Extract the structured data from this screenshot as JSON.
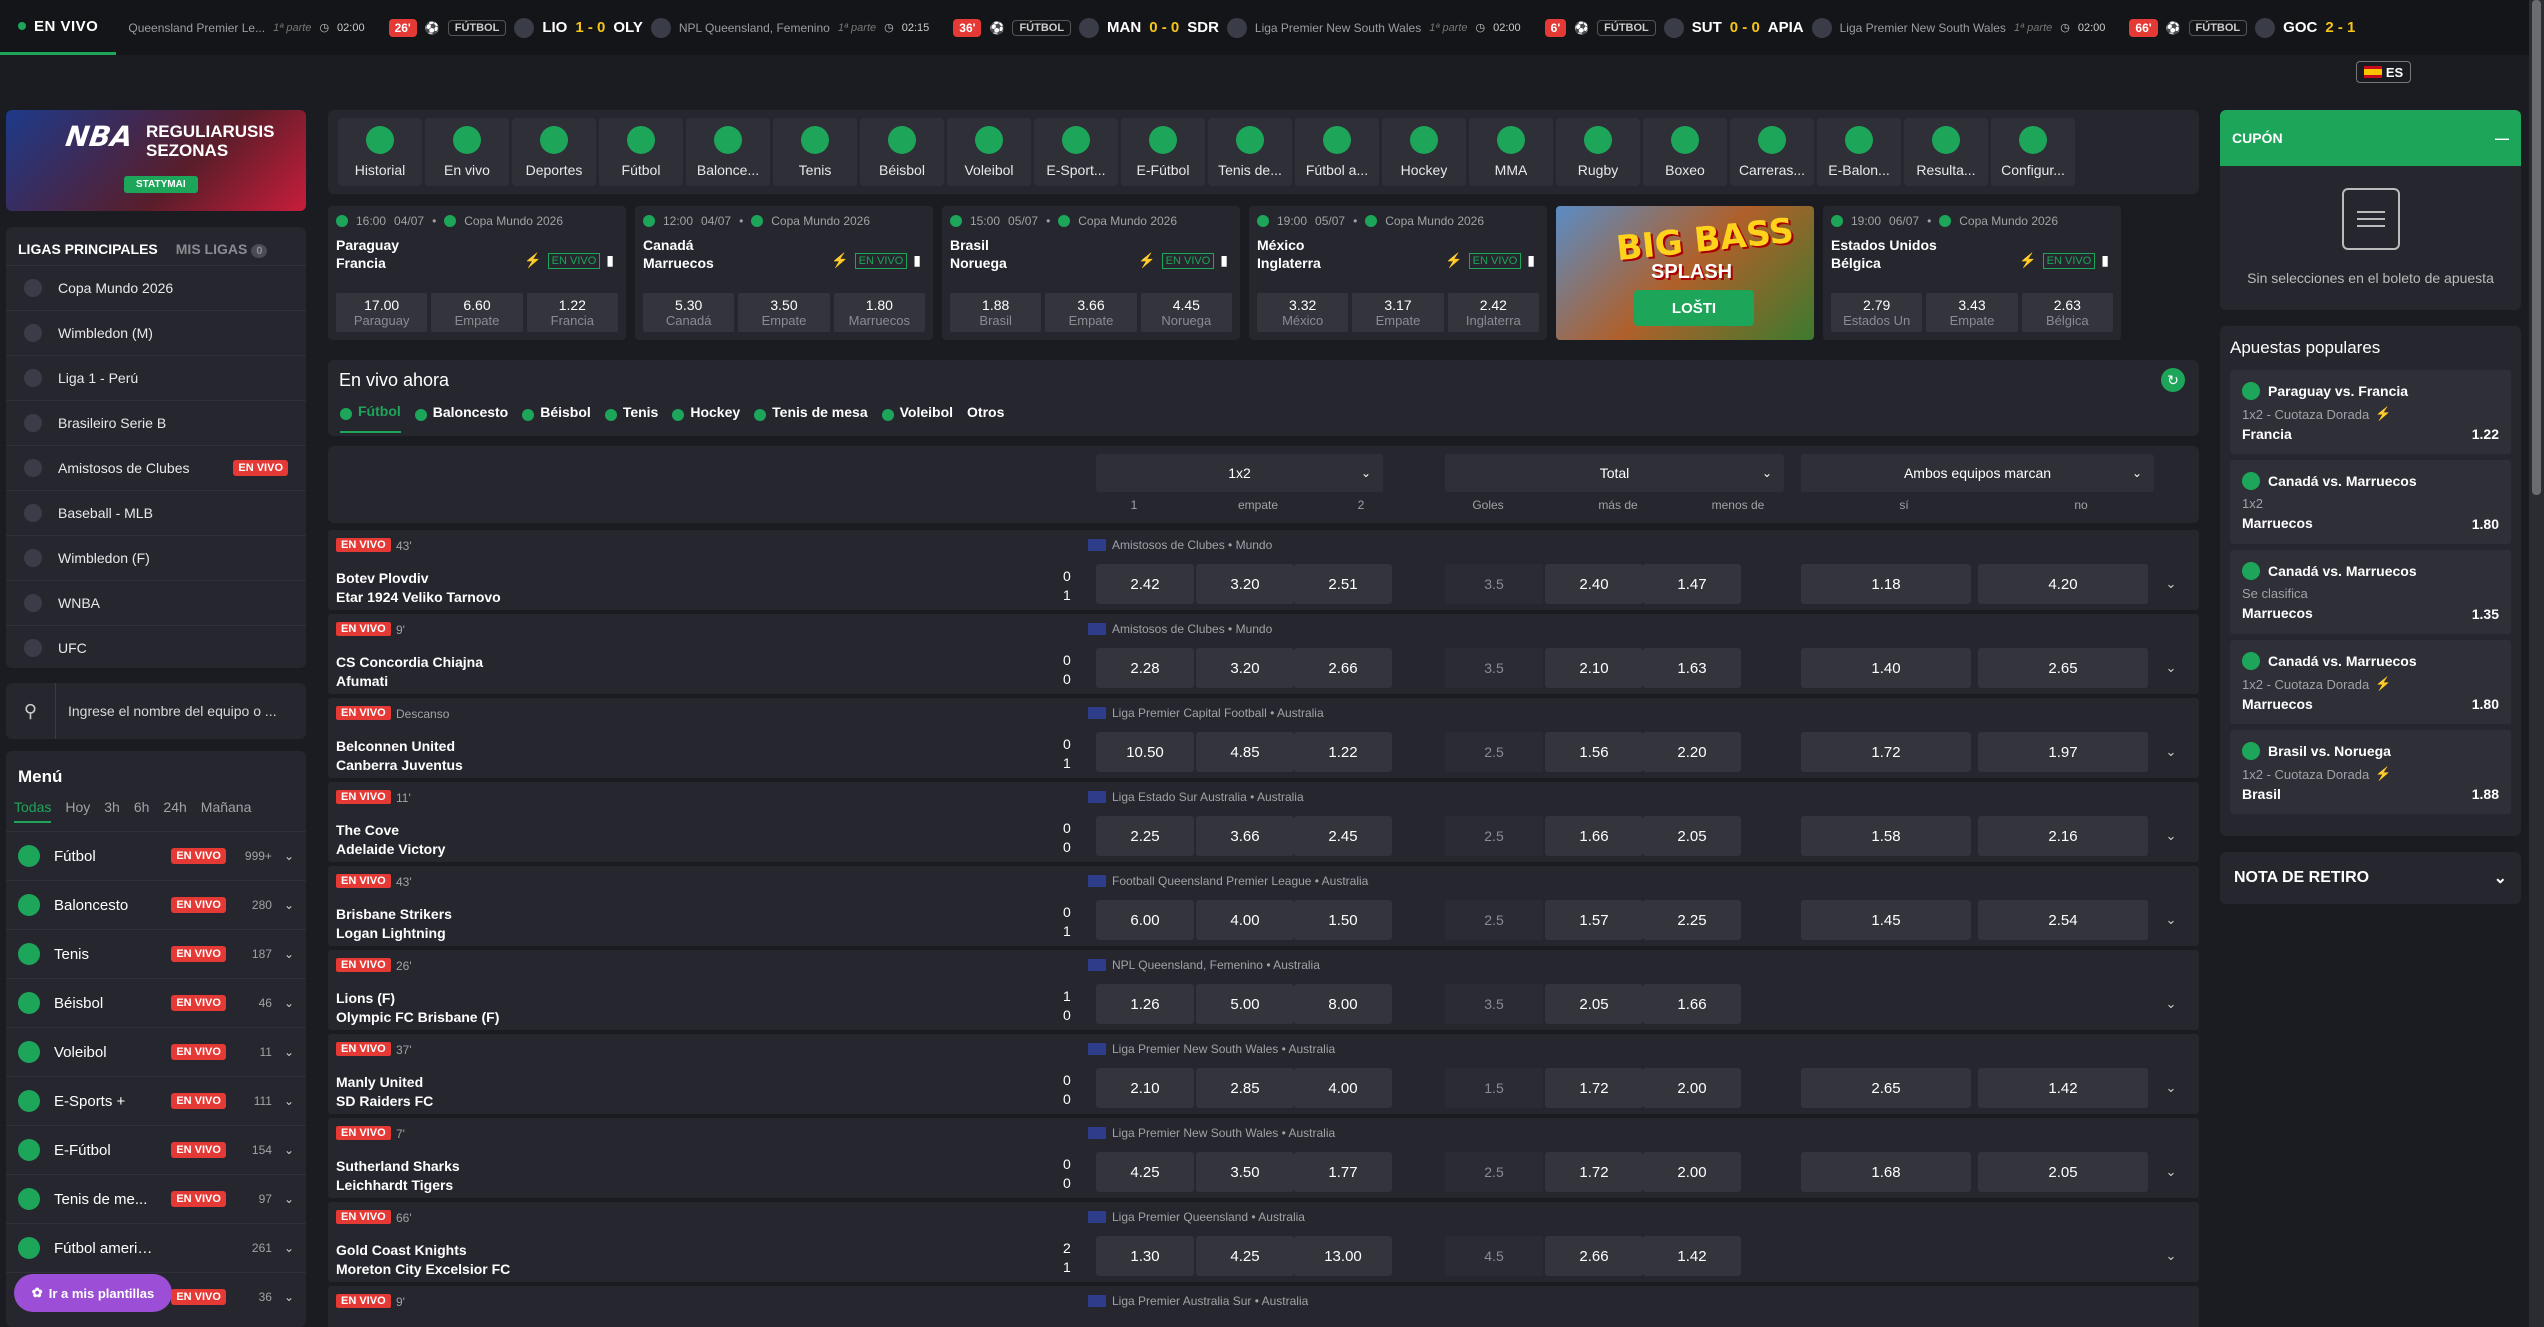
{
  "ticker": {
    "live_label": "EN VIVO",
    "items": [
      {
        "tail": "Queensland Premier Le...",
        "phase": "1ª parte",
        "clock": "02:00"
      },
      {
        "min": "26'",
        "sport": "FÚTBOL",
        "home": "LIO",
        "score": "1 - 0",
        "away": "OLY",
        "league": "NPL Queensland, Femenino",
        "phase": "1ª parte",
        "clock": "02:15"
      },
      {
        "min": "36'",
        "sport": "FÚTBOL",
        "home": "MAN",
        "score": "0 - 0",
        "away": "SDR",
        "league": "Liga Premier New South Wales",
        "phase": "1ª parte",
        "clock": "02:00"
      },
      {
        "min": "6'",
        "sport": "FÚTBOL",
        "home": "SUT",
        "score": "0 - 0",
        "away": "APIA",
        "league": "Liga Premier New South Wales",
        "phase": "1ª parte",
        "clock": "02:00"
      },
      {
        "min": "66'",
        "sport": "FÚTBOL",
        "home": "GOC",
        "score": "2 - 1",
        "away": "",
        "league": "",
        "phase": "",
        "clock": ""
      }
    ]
  },
  "lang": "ES",
  "nba": {
    "title": "NBA",
    "text": "REGULIARUSIS SEZONAS",
    "button": "STATYMAI"
  },
  "leagues": {
    "tab_main": "LIGAS PRINCIPALES",
    "tab_mine": "MIS LIGAS",
    "mine_count": "0",
    "items": [
      {
        "name": "Copa Mundo 2026",
        "live": ""
      },
      {
        "name": "Wimbledon (M)",
        "live": ""
      },
      {
        "name": "Liga 1 - Perú",
        "live": ""
      },
      {
        "name": "Brasileiro Serie B",
        "live": ""
      },
      {
        "name": "Amistosos de Clubes",
        "live": "EN VIVO"
      },
      {
        "name": "Baseball - MLB",
        "live": ""
      },
      {
        "name": "Wimbledon (F)",
        "live": ""
      },
      {
        "name": "WNBA",
        "live": ""
      },
      {
        "name": "UFC",
        "live": ""
      }
    ]
  },
  "search": {
    "placeholder": "Ingrese el nombre del equipo o ..."
  },
  "menu": {
    "title": "Menú",
    "tabs": [
      "Todas",
      "Hoy",
      "3h",
      "6h",
      "24h",
      "Mañana"
    ],
    "items": [
      {
        "name": "Fútbol",
        "live": "EN VIVO",
        "count": "999+"
      },
      {
        "name": "Baloncesto",
        "live": "EN VIVO",
        "count": "280"
      },
      {
        "name": "Tenis",
        "live": "EN VIVO",
        "count": "187"
      },
      {
        "name": "Béisbol",
        "live": "EN VIVO",
        "count": "46"
      },
      {
        "name": "Voleibol",
        "live": "EN VIVO",
        "count": "11"
      },
      {
        "name": "E-Sports +",
        "live": "EN VIVO",
        "count": "111"
      },
      {
        "name": "E-Fútbol",
        "live": "EN VIVO",
        "count": "154"
      },
      {
        "name": "Tenis de me...",
        "live": "EN VIVO",
        "count": "97"
      },
      {
        "name": "Fútbol americano",
        "live": "",
        "count": "261"
      },
      {
        "name": "",
        "live": "EN VIVO",
        "count": "36"
      }
    ],
    "templates_button": "Ir a mis plantillas"
  },
  "sports_bar": [
    "Historial",
    "En vivo",
    "Deportes",
    "Fútbol",
    "Balonce...",
    "Tenis",
    "Béisbol",
    "Voleibol",
    "E-Sport...",
    "E-Fútbol",
    "Tenis de...",
    "Fútbol a...",
    "Hockey",
    "MMA",
    "Rugby",
    "Boxeo",
    "Carreras...",
    "E-Balon...",
    "Resulta...",
    "Configur..."
  ],
  "featured": [
    {
      "time": "16:00",
      "date": "04/07",
      "league": "Copa Mundo 2026",
      "home": "Paraguay",
      "away": "Francia",
      "live": "EN VIVO",
      "odds": [
        {
          "v": "17.00",
          "l": "Paraguay"
        },
        {
          "v": "6.60",
          "l": "Empate"
        },
        {
          "v": "1.22",
          "l": "Francia"
        }
      ]
    },
    {
      "time": "12:00",
      "date": "04/07",
      "league": "Copa Mundo 2026",
      "home": "Canadá",
      "away": "Marruecos",
      "live": "EN VIVO",
      "odds": [
        {
          "v": "5.30",
          "l": "Canadá"
        },
        {
          "v": "3.50",
          "l": "Empate"
        },
        {
          "v": "1.80",
          "l": "Marruecos"
        }
      ]
    },
    {
      "time": "15:00",
      "date": "05/07",
      "league": "Copa Mundo 2026",
      "home": "Brasil",
      "away": "Noruega",
      "live": "EN VIVO",
      "odds": [
        {
          "v": "1.88",
          "l": "Brasil"
        },
        {
          "v": "3.66",
          "l": "Empate"
        },
        {
          "v": "4.45",
          "l": "Noruega"
        }
      ]
    },
    {
      "time": "19:00",
      "date": "05/07",
      "league": "Copa Mundo 2026",
      "home": "México",
      "away": "Inglaterra",
      "live": "EN VIVO",
      "odds": [
        {
          "v": "3.32",
          "l": "México"
        },
        {
          "v": "3.17",
          "l": "Empate"
        },
        {
          "v": "2.42",
          "l": "Inglaterra"
        }
      ]
    },
    {
      "time": "19:00",
      "date": "06/07",
      "league": "Copa Mundo 2026",
      "home": "Estados Unidos",
      "away": "Bélgica",
      "live": "EN VIVO",
      "odds": [
        {
          "v": "2.79",
          "l": "Estados Un"
        },
        {
          "v": "3.43",
          "l": "Empate"
        },
        {
          "v": "2.63",
          "l": "Bélgica"
        }
      ]
    }
  ],
  "banner": {
    "title": "BIG BASS",
    "subtitle": "SPLASH",
    "button": "LOŠTI"
  },
  "live_now": {
    "title": "En vivo ahora",
    "tabs": [
      "Fútbol",
      "Baloncesto",
      "Béisbol",
      "Tenis",
      "Hockey",
      "Tenis de mesa",
      "Voleibol",
      "Otros"
    ]
  },
  "markets": {
    "m1": {
      "title": "1x2",
      "cols": [
        "1",
        "empate",
        "2"
      ]
    },
    "m2": {
      "title": "Total",
      "cols": [
        "Goles",
        "más de",
        "menos de"
      ]
    },
    "m3": {
      "title": "Ambos equipos marcan",
      "cols": [
        "sí",
        "no"
      ]
    }
  },
  "matches": [
    {
      "live": "EN VIVO",
      "time": "43'",
      "league": "Amistosos de Clubes • Mundo",
      "home": "Botev Plovdiv",
      "away": "Etar 1924 Veliko Tarnovo",
      "sh": "0",
      "sa": "1",
      "o": [
        "2.42",
        "3.20",
        "2.51",
        "3.5",
        "2.40",
        "1.47",
        "1.18",
        "4.20"
      ]
    },
    {
      "live": "EN VIVO",
      "time": "9'",
      "league": "Amistosos de Clubes • Mundo",
      "home": "CS Concordia Chiajna",
      "away": "Afumati",
      "sh": "0",
      "sa": "0",
      "o": [
        "2.28",
        "3.20",
        "2.66",
        "3.5",
        "2.10",
        "1.63",
        "1.40",
        "2.65"
      ]
    },
    {
      "live": "EN VIVO",
      "time": "Descanso",
      "league": "Liga Premier Capital Football • Australia",
      "home": "Belconnen United",
      "away": "Canberra Juventus",
      "sh": "0",
      "sa": "1",
      "o": [
        "10.50",
        "4.85",
        "1.22",
        "2.5",
        "1.56",
        "2.20",
        "1.72",
        "1.97"
      ]
    },
    {
      "live": "EN VIVO",
      "time": "11'",
      "league": "Liga Estado Sur Australia • Australia",
      "home": "The Cove",
      "away": "Adelaide Victory",
      "sh": "0",
      "sa": "0",
      "o": [
        "2.25",
        "3.66",
        "2.45",
        "2.5",
        "1.66",
        "2.05",
        "1.58",
        "2.16"
      ]
    },
    {
      "live": "EN VIVO",
      "time": "43'",
      "league": "Football Queensland Premier League • Australia",
      "home": "Brisbane Strikers",
      "away": "Logan Lightning",
      "sh": "0",
      "sa": "1",
      "o": [
        "6.00",
        "4.00",
        "1.50",
        "2.5",
        "1.57",
        "2.25",
        "1.45",
        "2.54"
      ]
    },
    {
      "live": "EN VIVO",
      "time": "26'",
      "league": "NPL Queensland, Femenino • Australia",
      "home": "Lions (F)",
      "away": "Olympic FC Brisbane (F)",
      "sh": "1",
      "sa": "0",
      "o": [
        "1.26",
        "5.00",
        "8.00",
        "3.5",
        "2.05",
        "1.66",
        "",
        ""
      ]
    },
    {
      "live": "EN VIVO",
      "time": "37'",
      "league": "Liga Premier New South Wales • Australia",
      "home": "Manly United",
      "away": "SD Raiders FC",
      "sh": "0",
      "sa": "0",
      "o": [
        "2.10",
        "2.85",
        "4.00",
        "1.5",
        "1.72",
        "2.00",
        "2.65",
        "1.42"
      ]
    },
    {
      "live": "EN VIVO",
      "time": "7'",
      "league": "Liga Premier New South Wales • Australia",
      "home": "Sutherland Sharks",
      "away": "Leichhardt Tigers",
      "sh": "0",
      "sa": "0",
      "o": [
        "4.25",
        "3.50",
        "1.77",
        "2.5",
        "1.72",
        "2.00",
        "1.68",
        "2.05"
      ]
    },
    {
      "live": "EN VIVO",
      "time": "66'",
      "league": "Liga Premier Queensland • Australia",
      "home": "Gold Coast Knights",
      "away": "Moreton City Excelsior FC",
      "sh": "2",
      "sa": "1",
      "o": [
        "1.30",
        "4.25",
        "13.00",
        "4.5",
        "2.66",
        "1.42",
        "",
        ""
      ]
    },
    {
      "live": "EN VIVO",
      "time": "9'",
      "league": "Liga Premier Australia Sur • Australia",
      "home": "",
      "away": "",
      "sh": "",
      "sa": "",
      "o": [
        "",
        "",
        "",
        "",
        "",
        "",
        "",
        ""
      ]
    }
  ],
  "coupon": {
    "title": "CUPÓN",
    "empty": "Sin selecciones en el boleto de apuesta"
  },
  "popular": {
    "title": "Apuestas populares",
    "items": [
      {
        "match": "Paraguay vs. Francia",
        "market": "1x2 - Cuotaza Dorada",
        "bolt": true,
        "selection": "Francia",
        "odd": "1.22"
      },
      {
        "match": "Canadá vs. Marruecos",
        "market": "1x2",
        "bolt": false,
        "selection": "Marruecos",
        "odd": "1.80"
      },
      {
        "match": "Canadá vs. Marruecos",
        "market": "Se clasifica",
        "bolt": false,
        "selection": "Marruecos",
        "odd": "1.35"
      },
      {
        "match": "Canadá vs. Marruecos",
        "market": "1x2 - Cuotaza Dorada",
        "bolt": true,
        "selection": "Marruecos",
        "odd": "1.80"
      },
      {
        "match": "Brasil vs. Noruega",
        "market": "1x2 - Cuotaza Dorada",
        "bolt": true,
        "selection": "Brasil",
        "odd": "1.88"
      }
    ]
  },
  "nota": "NOTA DE RETIRO"
}
